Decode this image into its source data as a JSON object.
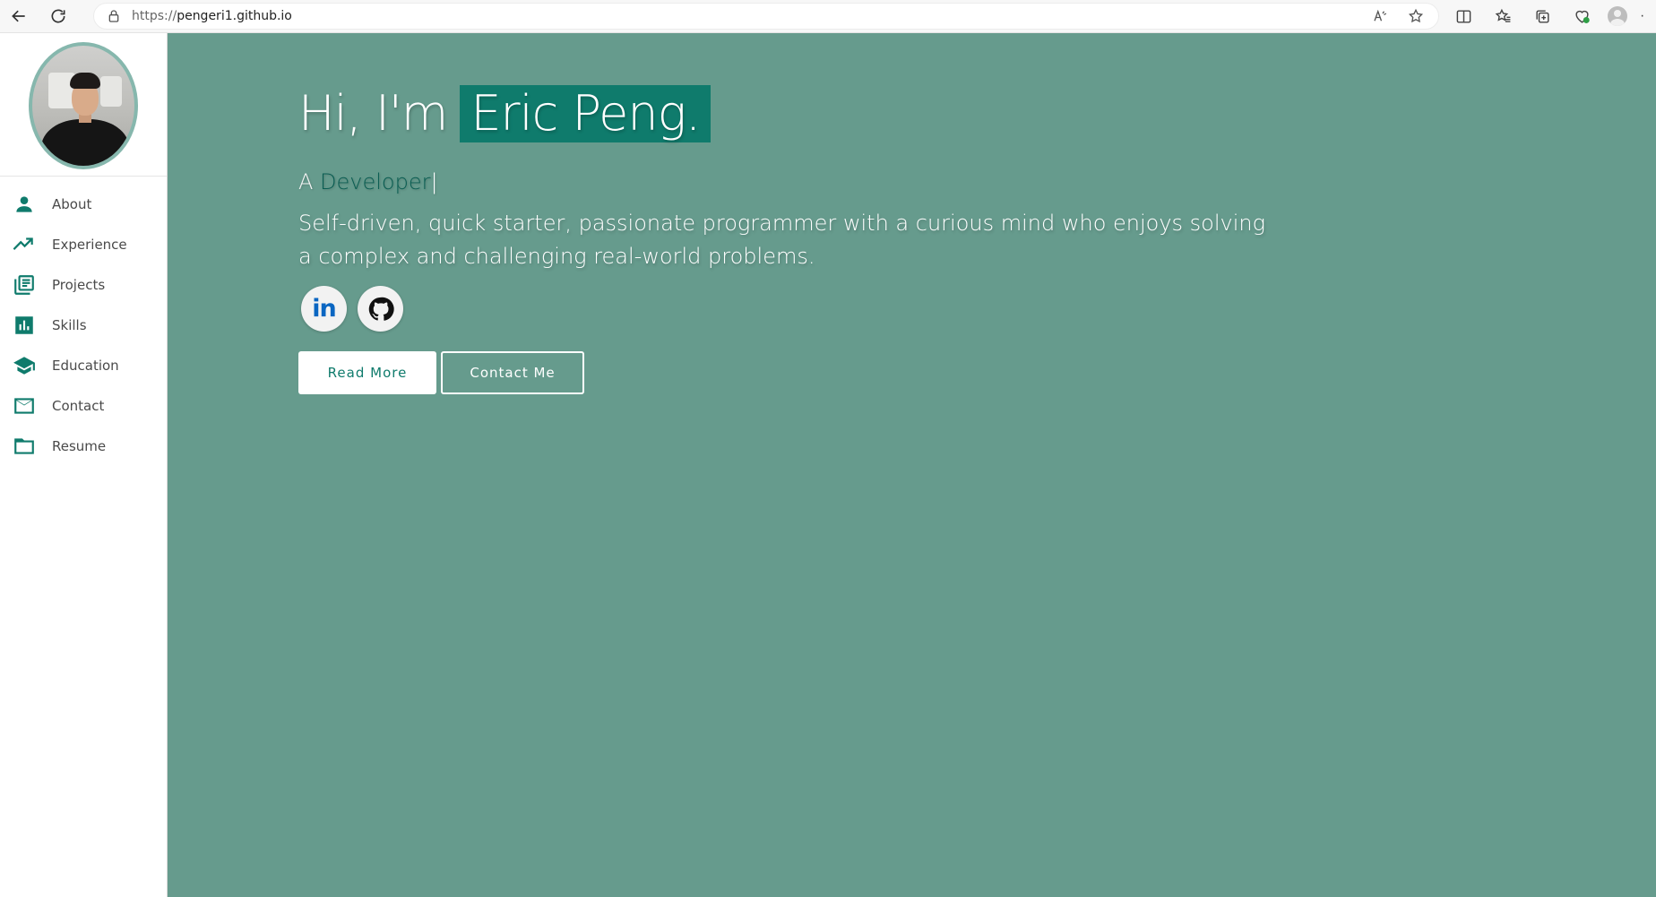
{
  "browser": {
    "url_scheme": "https://",
    "url_host": "pengeri1.github.io",
    "more_label": "·"
  },
  "sidebar": {
    "items": [
      {
        "label": "About",
        "icon": "person-icon"
      },
      {
        "label": "Experience",
        "icon": "trending-up-icon"
      },
      {
        "label": "Projects",
        "icon": "library-books-icon"
      },
      {
        "label": "Skills",
        "icon": "bar-chart-icon"
      },
      {
        "label": "Education",
        "icon": "school-icon"
      },
      {
        "label": "Contact",
        "icon": "mail-icon"
      },
      {
        "label": "Resume",
        "icon": "folder-icon"
      }
    ]
  },
  "hero": {
    "greeting": "Hi, I'm",
    "name": "Eric Peng.",
    "role_prefix": "A ",
    "role_word": "Developer",
    "caret": "|",
    "bio": "Self-driven, quick starter, passionate programmer with a curious mind who enjoys solving a complex and challenging real-world problems.",
    "linkedin_text": "in",
    "read_more": "Read More",
    "contact_me": "Contact Me"
  },
  "colors": {
    "hero_bg": "#669b8d",
    "accent": "#0f7b6c",
    "role_word": "#0a5d52",
    "linkedin": "#0a66c2"
  }
}
